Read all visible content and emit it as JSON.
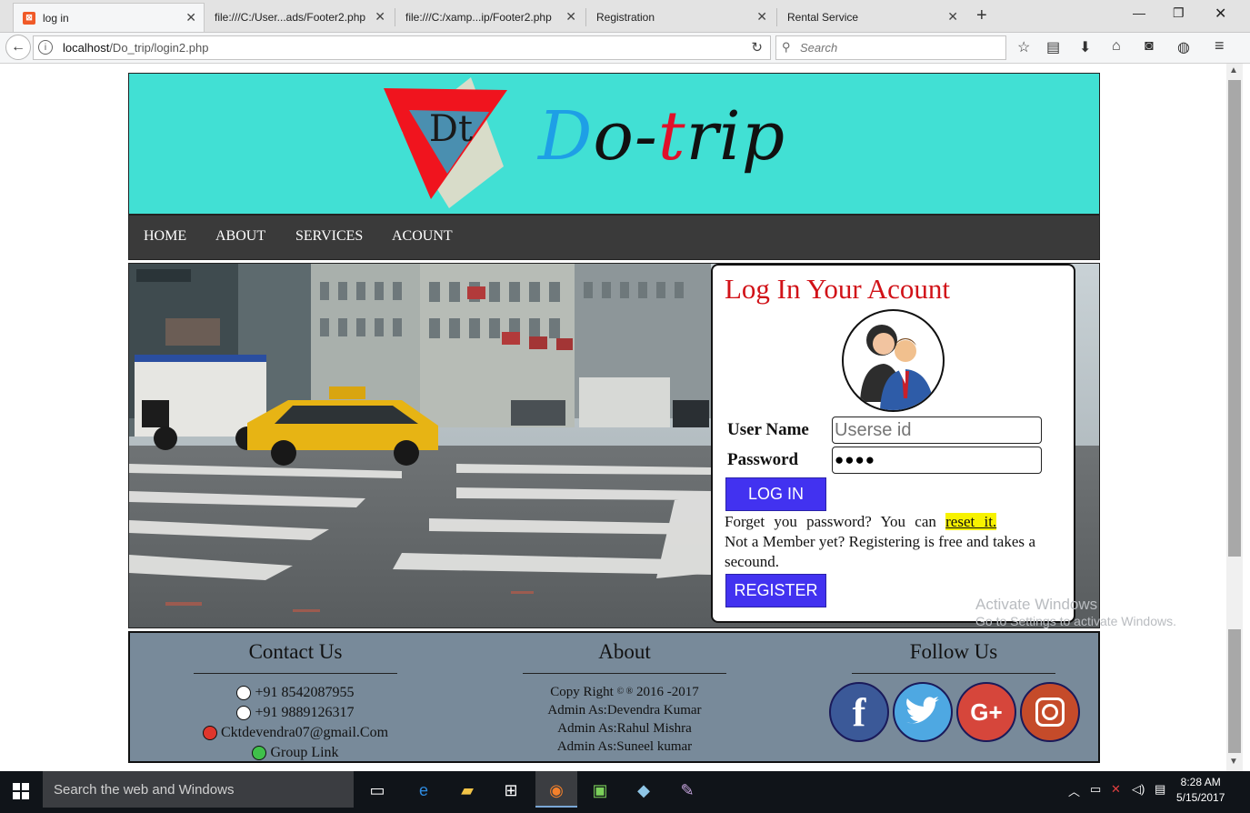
{
  "browser": {
    "tabs": [
      {
        "title": "log in",
        "active": true
      },
      {
        "title": "file:///C:/User...ads/Footer2.php",
        "active": false
      },
      {
        "title": "file:///C:/xamp...ip/Footer2.php",
        "active": false
      },
      {
        "title": "Registration",
        "active": false
      },
      {
        "title": "Rental Service",
        "active": false
      }
    ],
    "url_host": "localhost",
    "url_path": "/Do_trip/login2.php",
    "search_placeholder": "Search"
  },
  "site": {
    "logo_text": "Dt",
    "brand_d": "D",
    "brand_mid": "o-",
    "brand_t": "t",
    "brand_end": "rip",
    "nav": [
      "HOME",
      "ABOUT",
      "SERVICES",
      "ACOUNT"
    ]
  },
  "login": {
    "title": "Log In Your Acount",
    "username_label": "User Name",
    "username_placeholder": "Userse id",
    "password_label": "Password",
    "password_value": "●●●●",
    "login_button": "LOG IN",
    "forgot_text": "Forget you password? You can",
    "reset_link": "reset it.",
    "member_text": "Not a Member yet? Registering is free and takes a secound.",
    "register_button": "REGISTER"
  },
  "footer": {
    "contact": {
      "title": "Contact Us",
      "phone1": "+91 8542087955",
      "phone2": "+91 9889126317",
      "email": "Cktdevendra07@gmail.Com",
      "group": "Group Link"
    },
    "about": {
      "title": "About",
      "copyright_pre": "Copy Right",
      "copyright_marks": "© ®",
      "copyright_years": "2016 -2017",
      "admins": [
        "Admin As:Devendra Kumar",
        "Admin As:Rahul Mishra",
        "Admin As:Suneel kumar"
      ]
    },
    "follow": {
      "title": "Follow Us",
      "facebook": "f",
      "google": "G+"
    }
  },
  "watermark": {
    "line1": "Activate Windows",
    "line2": "Go to Settings to activate Windows."
  },
  "taskbar": {
    "search_text": "Search the web and Windows",
    "time": "8:28 AM",
    "date": "5/15/2017"
  },
  "colors": {
    "header_bg": "#41e0d4",
    "menu_bg": "#3a3a3a",
    "login_title": "#d11218",
    "button_bg": "#4232f0",
    "footer_bg": "#788a9a",
    "reset_highlight": "#f7f200"
  }
}
